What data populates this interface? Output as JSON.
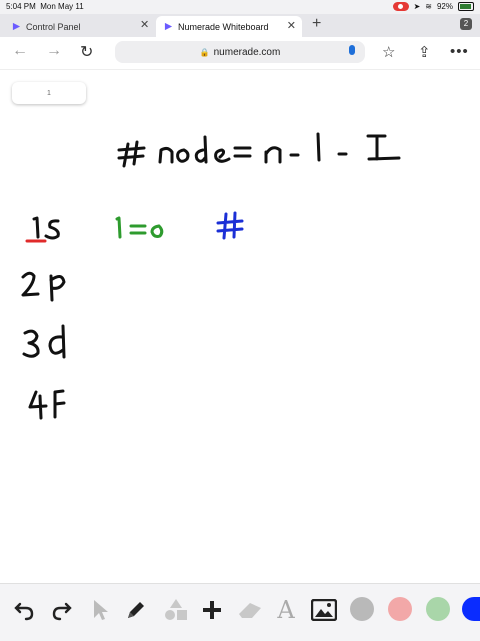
{
  "status": {
    "time": "5:04 PM",
    "date": "Mon May 11",
    "battery": "92%"
  },
  "tabs": [
    {
      "label": "Control Panel"
    },
    {
      "label": "Numerade Whiteboard"
    }
  ],
  "tab_count": "2",
  "url": "numerade.com",
  "page_number": "1",
  "colors": {
    "ink": "#111111",
    "red": "#e02a2a",
    "green": "#2e9b2e",
    "blue": "#1b2fd6",
    "swatch_gray": "#b9b9b9",
    "swatch_pink": "#f2a8a8",
    "swatch_green": "#a9d6a9",
    "swatch_blue": "#0a2cff"
  },
  "icons": [
    "undo-icon",
    "redo-icon",
    "pointer-icon",
    "pencil-icon",
    "shapes-icon",
    "add-icon",
    "eraser-icon",
    "text-icon",
    "image-icon"
  ]
}
